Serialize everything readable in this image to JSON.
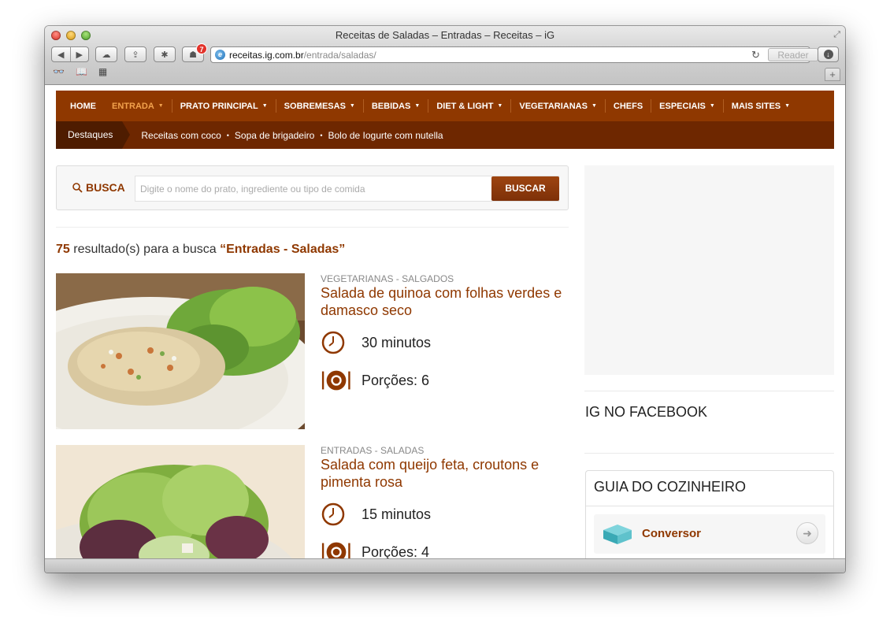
{
  "window": {
    "title": "Receitas de Saladas – Entradas – Receitas – iG",
    "notification_count": "7",
    "url_domain": "receitas.ig.com.br",
    "url_path": "/entrada/saladas/",
    "reader_label": "Reader"
  },
  "nav": {
    "items": [
      {
        "label": "HOME",
        "dropdown": false
      },
      {
        "label": "ENTRADA",
        "dropdown": true,
        "active": true
      },
      {
        "label": "PRATO PRINCIPAL",
        "dropdown": true
      },
      {
        "label": "SOBREMESAS",
        "dropdown": true
      },
      {
        "label": "BEBIDAS",
        "dropdown": true
      },
      {
        "label": "DIET & LIGHT",
        "dropdown": true
      },
      {
        "label": "VEGETARIANAS",
        "dropdown": true
      },
      {
        "label": "CHEFS",
        "dropdown": false
      },
      {
        "label": "ESPECIAIS",
        "dropdown": true
      },
      {
        "label": "MAIS SITES",
        "dropdown": true
      }
    ],
    "destaques_label": "Destaques",
    "highlights": [
      "Receitas com coco",
      "Sopa de brigadeiro",
      "Bolo de Iogurte com nutella"
    ]
  },
  "search": {
    "label": "BUSCA",
    "placeholder": "Digite o nome do prato, ingrediente ou tipo de comida",
    "button": "BUSCAR"
  },
  "results": {
    "count": "75",
    "text": " resultado(s) para a busca ",
    "query": "“Entradas - Saladas”"
  },
  "recipes": [
    {
      "category": "VEGETARIANAS - SALGADOS",
      "title": "Salada de quinoa com folhas verdes e damasco seco",
      "time": "30 minutos",
      "servings": "Porções: 6"
    },
    {
      "category": "ENTRADAS - SALADAS",
      "title": "Salada com queijo feta, croutons e pimenta rosa",
      "time": "15 minutos",
      "servings": "Porções: 4"
    }
  ],
  "sidebar": {
    "facebook_title": "IG NO FACEBOOK",
    "guia_title": "GUIA DO COZINHEIRO",
    "conversor_label": "Conversor"
  },
  "colors": {
    "brand": "#8f3800",
    "nav_bottom": "#6e2700",
    "active_nav": "#f2a24d"
  }
}
